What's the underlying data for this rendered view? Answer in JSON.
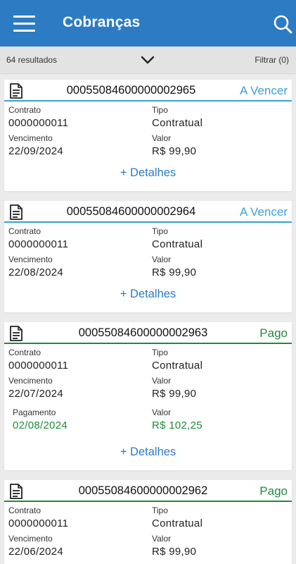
{
  "header": {
    "title": "Cobranças"
  },
  "filter_bar": {
    "results": "64 resultados",
    "filter_label": "Filtrar (0)"
  },
  "labels": {
    "contract": "Contrato",
    "type": "Tipo",
    "due": "Vencimento",
    "value": "Valor",
    "payment": "Pagamento",
    "details": "+ Detalhes"
  },
  "colors": {
    "appbar": "#2c7bc3",
    "due_status": "#3a9fd6",
    "paid_status": "#1f8a3c"
  },
  "icons": {
    "menu": "menu-icon",
    "search": "search-icon",
    "filter_toggle": "chevron-down-icon",
    "document": "document-icon"
  },
  "cards": [
    {
      "number": "00055084600000002965",
      "status": "A Vencer",
      "contract": "0000000011",
      "type": "Contratual",
      "due_date": "22/09/2024",
      "value": "R$ 99,90"
    },
    {
      "number": "00055084600000002964",
      "status": "A Vencer",
      "contract": "0000000011",
      "type": "Contratual",
      "due_date": "22/08/2024",
      "value": "R$ 99,90"
    },
    {
      "number": "00055084600000002963",
      "status": "Pago",
      "contract": "0000000011",
      "type": "Contratual",
      "due_date": "22/07/2024",
      "value": "R$ 99,90",
      "payment_date": "02/08/2024",
      "paid_value": "R$ 102,25"
    },
    {
      "number": "00055084600000002962",
      "status": "Pago",
      "contract": "0000000011",
      "type": "Contratual",
      "due_date": "22/06/2024",
      "value": "R$ 99,90"
    }
  ]
}
